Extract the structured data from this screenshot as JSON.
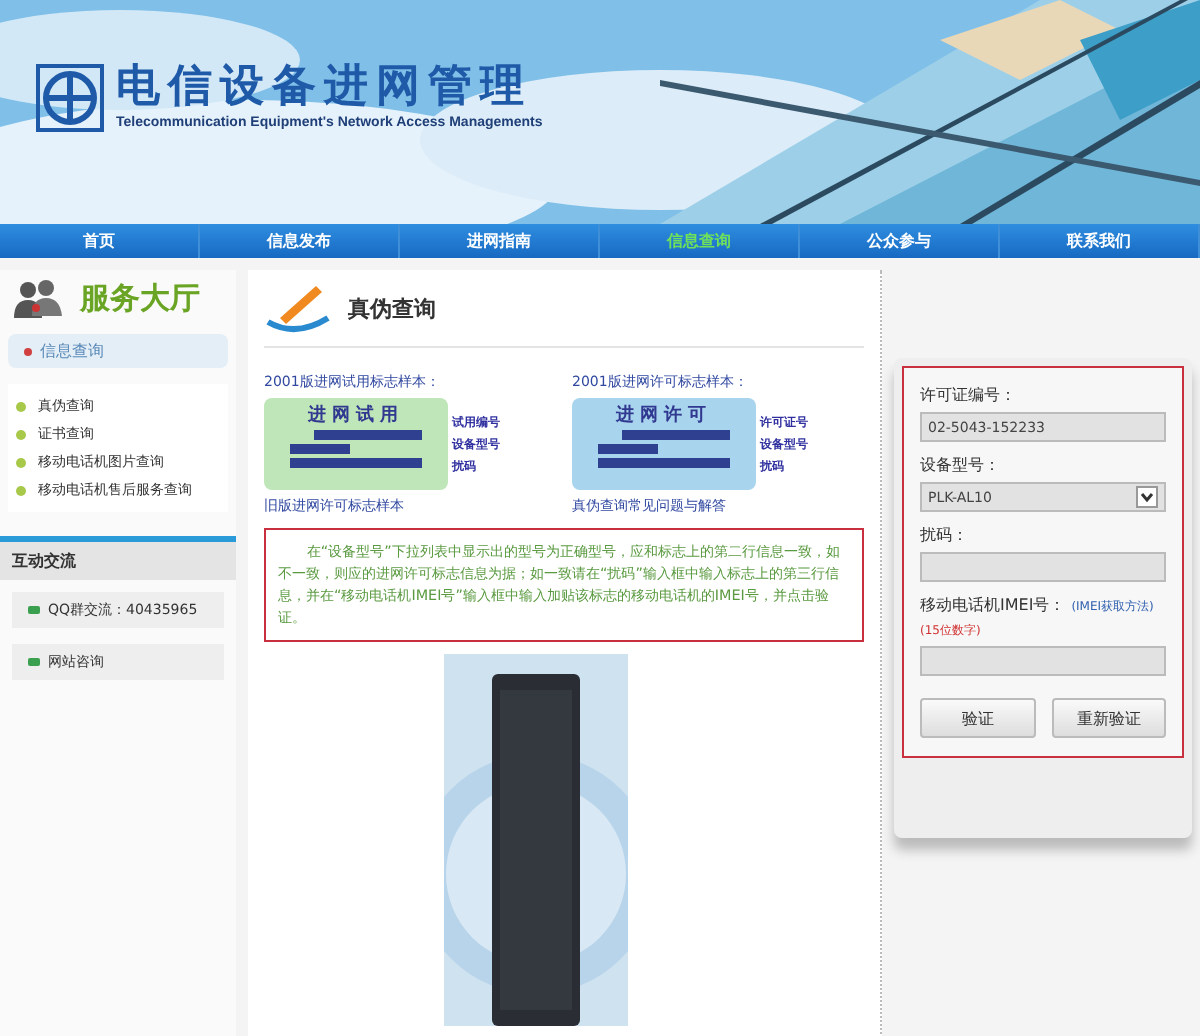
{
  "header": {
    "title": "电信设备进网管理",
    "subtitle": "Telecommunication Equipment's Network Access Managements"
  },
  "nav": [
    {
      "label": "首页",
      "selected": false
    },
    {
      "label": "信息发布",
      "selected": false
    },
    {
      "label": "进网指南",
      "selected": false
    },
    {
      "label": "信息查询",
      "selected": true
    },
    {
      "label": "公众参与",
      "selected": false
    },
    {
      "label": "联系我们",
      "selected": false
    }
  ],
  "sidebar": {
    "title": "服务大厅",
    "tab": "信息查询",
    "items": [
      "真伪查询",
      "证书查询",
      "移动电话机图片查询",
      "移动电话机售后服务查询"
    ],
    "section": "互动交流",
    "links": [
      "QQ群交流：40435965",
      "网站咨询"
    ]
  },
  "main": {
    "title": "真伪查询",
    "samples": [
      {
        "caption": "2001版进网试用标志样本：",
        "stamp": "进网试用",
        "kind": "trial",
        "labels": [
          "试用编号",
          "设备型号",
          "扰码"
        ],
        "link": "旧版进网许可标志样本"
      },
      {
        "caption": "2001版进网许可标志样本：",
        "stamp": "进网许可",
        "kind": "license",
        "labels": [
          "许可证号",
          "设备型号",
          "扰码"
        ],
        "link": "真伪查询常见问题与解答"
      }
    ],
    "note": "在“设备型号”下拉列表中显示出的型号为正确型号，应和标志上的第二行信息一致，如不一致，则应的进网许可标志信息为据；如一致请在“扰码”输入框中输入标志上的第三行信息，并在“移动电话机IMEI号”输入框中输入加贴该标志的移动电话机的IMEI号，并点击验证。"
  },
  "form": {
    "fields": [
      {
        "label": "许可证编号：",
        "kind": "text",
        "value": "02-5043-152233"
      },
      {
        "label": "设备型号：",
        "kind": "select",
        "value": "PLK-AL10"
      },
      {
        "label": "扰码：",
        "kind": "text"
      },
      {
        "label": "移动电话机IMEI号：",
        "kind": "text",
        "link": "(IMEI获取方法)",
        "hint": "(15位数字)"
      }
    ],
    "buttons": [
      "验证",
      "重新验证"
    ]
  }
}
